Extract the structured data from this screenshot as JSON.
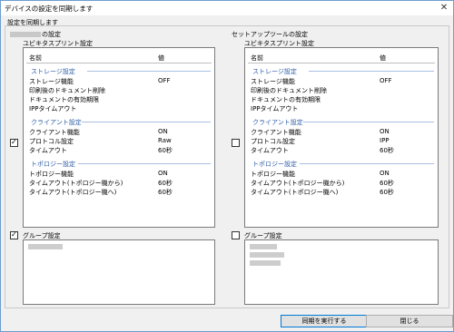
{
  "window": {
    "title": "デバイスの設定を同期します",
    "close_glyph": "✕"
  },
  "sync_label": "設定を同期します",
  "left": {
    "title": "の設定",
    "subtitle": "ユビキタスプリント設定",
    "list_checked": true,
    "columns": {
      "name": "名前",
      "value": "値"
    },
    "sections": {
      "storage": {
        "title": "ストレージ設定",
        "rows": [
          {
            "k": "ストレージ機能",
            "v": "OFF"
          },
          {
            "k": "印刷後のドキュメント削除",
            "v": ""
          },
          {
            "k": "ドキュメントの有効期限",
            "v": ""
          },
          {
            "k": "IPPタイムアウト",
            "v": ""
          }
        ]
      },
      "client": {
        "title": "クライアント設定",
        "rows": [
          {
            "k": "クライアント機能",
            "v": "ON"
          },
          {
            "k": "プロトコル設定",
            "v": "Raw"
          },
          {
            "k": "タイムアウト",
            "v": "60秒"
          }
        ]
      },
      "topology": {
        "title": "トポロジー設定",
        "rows": [
          {
            "k": "トポロジー機能",
            "v": "ON"
          },
          {
            "k": "タイムアウト(トポロジー機から)",
            "v": "60秒"
          },
          {
            "k": "タイムアウト(トポロジー機へ)",
            "v": "60秒"
          }
        ]
      }
    },
    "group_checked": true,
    "group_label": "グループ設定"
  },
  "right": {
    "title": "セットアップツールの設定",
    "subtitle": "ユビキタスプリント設定",
    "list_checked": false,
    "columns": {
      "name": "名前",
      "value": "値"
    },
    "sections": {
      "storage": {
        "title": "ストレージ設定",
        "rows": [
          {
            "k": "ストレージ機能",
            "v": "OFF"
          },
          {
            "k": "印刷後のドキュメント削除",
            "v": ""
          },
          {
            "k": "ドキュメントの有効期限",
            "v": ""
          },
          {
            "k": "IPPタイムアウト",
            "v": ""
          }
        ]
      },
      "client": {
        "title": "クライアント設定",
        "rows": [
          {
            "k": "クライアント機能",
            "v": "ON"
          },
          {
            "k": "プロトコル設定",
            "v": "IPP"
          },
          {
            "k": "タイムアウト",
            "v": "60秒"
          }
        ]
      },
      "topology": {
        "title": "トポロジー設定",
        "rows": [
          {
            "k": "トポロジー機能",
            "v": "ON"
          },
          {
            "k": "タイムアウト(トポロジー機から)",
            "v": "60秒"
          },
          {
            "k": "タイムアウト(トポロジー機へ)",
            "v": "60秒"
          }
        ]
      }
    },
    "group_checked": false,
    "group_label": "グループ設定"
  },
  "buttons": {
    "run": "同期を実行する",
    "close": "閉じる"
  },
  "colors": {
    "section_title": "#2e5ea6",
    "window_border": "#6e9ccf",
    "primary_border": "#0078d7"
  }
}
